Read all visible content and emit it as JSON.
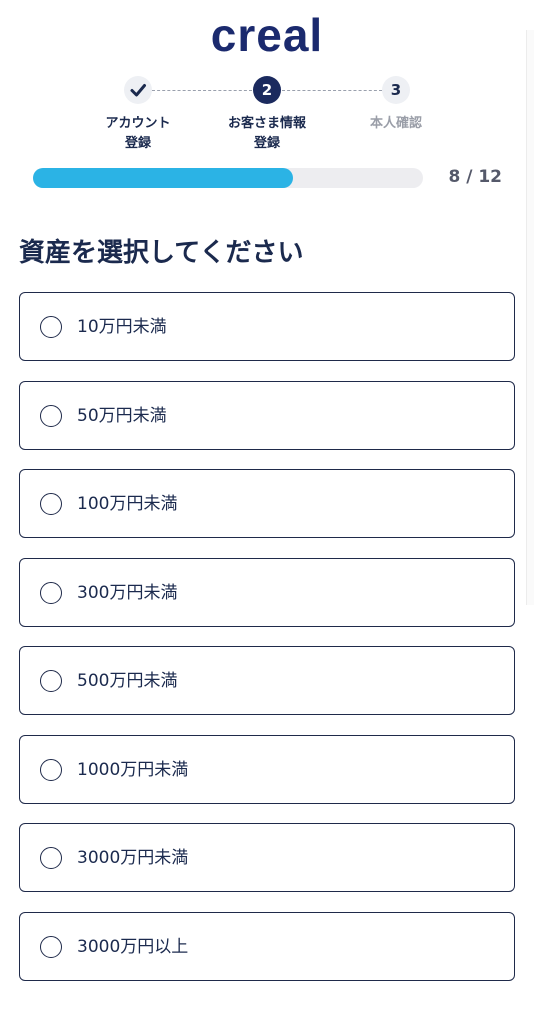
{
  "header": {
    "logo_text": "creal"
  },
  "stepper": {
    "steps": [
      {
        "number": "1",
        "label_line1": "アカウント",
        "label_line2": "登録",
        "state": "completed",
        "icon": "check-icon"
      },
      {
        "number": "2",
        "label_line1": "お客さま情報",
        "label_line2": "登録",
        "state": "active"
      },
      {
        "number": "3",
        "label_line1": "本人確認",
        "label_line2": "",
        "state": "pending"
      }
    ]
  },
  "progress": {
    "current": 8,
    "total": 12,
    "label": "8 / 12",
    "fill_color": "#2bb3e5"
  },
  "page": {
    "title": "資産を選択してください"
  },
  "asset_options": [
    {
      "label": "10万円未満",
      "selected": false
    },
    {
      "label": "50万円未満",
      "selected": false
    },
    {
      "label": "100万円未満",
      "selected": false
    },
    {
      "label": "300万円未満",
      "selected": false
    },
    {
      "label": "500万円未満",
      "selected": false
    },
    {
      "label": "1000万円未満",
      "selected": false
    },
    {
      "label": "3000万円未満",
      "selected": false
    },
    {
      "label": "3000万円以上",
      "selected": false
    }
  ],
  "colors": {
    "brand_navy": "#1b2a5e",
    "accent_blue": "#2bb3e5"
  }
}
